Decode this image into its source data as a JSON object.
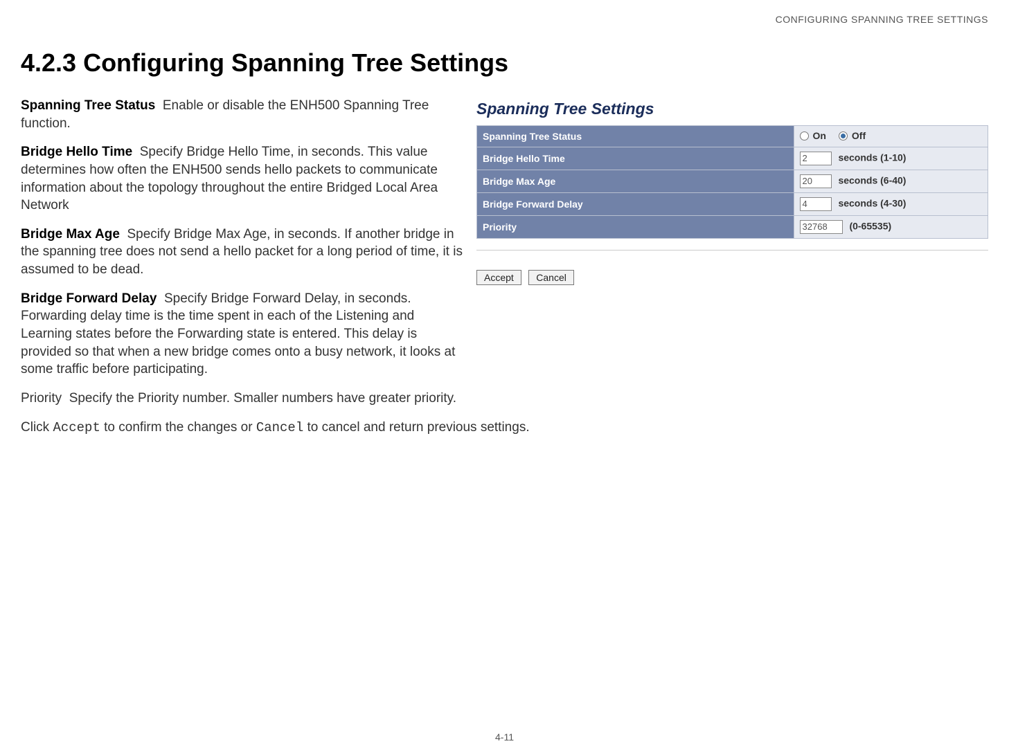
{
  "header": {
    "running_head": "CONFIGURING SPANNING TREE SETTINGS"
  },
  "title": "4.2.3 Configuring Spanning Tree Settings",
  "defs": {
    "status": {
      "term": "Spanning Tree Status",
      "text": "Enable or disable the ENH500 Spanning Tree function."
    },
    "hello": {
      "term": "Bridge Hello Time",
      "text": "Specify Bridge Hello Time, in seconds. This value determines how often the ENH500 sends hello packets to communicate information about the topology throughout the entire Bridged Local Area Network"
    },
    "maxage": {
      "term": "Bridge Max Age",
      "text": "Specify Bridge Max Age, in seconds. If another bridge in the spanning tree does not send a hello packet for a long period of time, it is assumed to be dead."
    },
    "fwd": {
      "term": "Bridge Forward Delay",
      "text": "Specify Bridge Forward Delay, in seconds. Forwarding delay time is the time spent in each of the Listening and Learning states before the Forwarding state is entered. This delay is provided so that when a new bridge comes onto a busy network, it looks at some traffic before participating."
    },
    "priority": {
      "term": "Priority",
      "text": "Specify the Priority number. Smaller numbers have greater priority."
    }
  },
  "closing": {
    "pre": "Click ",
    "accept": "Accept",
    "mid": " to confirm the changes or ",
    "cancel": "Cancel",
    "post": " to cancel and return previous settings."
  },
  "panel": {
    "title": "Spanning Tree Settings",
    "rows": {
      "status": {
        "label": "Spanning Tree Status",
        "on": "On",
        "off": "Off",
        "selected": "off"
      },
      "hello": {
        "label": "Bridge Hello Time",
        "value": "2",
        "range": "seconds (1-10)"
      },
      "maxage": {
        "label": "Bridge Max Age",
        "value": "20",
        "range": "seconds (6-40)"
      },
      "fwd": {
        "label": "Bridge Forward Delay",
        "value": "4",
        "range": "seconds (4-30)"
      },
      "priority": {
        "label": "Priority",
        "value": "32768",
        "range": "(0-65535)"
      }
    },
    "buttons": {
      "accept": "Accept",
      "cancel": "Cancel"
    }
  },
  "footer": {
    "page": "4-11"
  }
}
